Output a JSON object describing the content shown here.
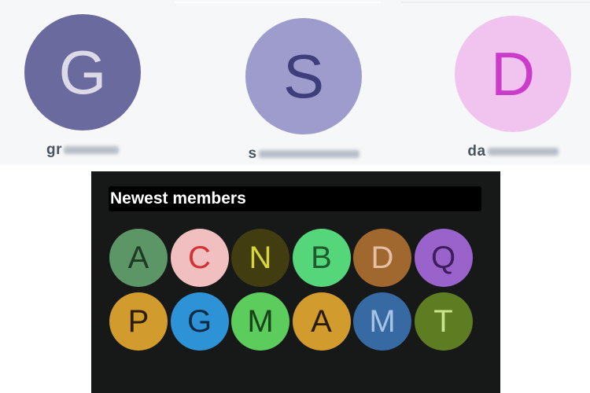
{
  "profiles": [
    {
      "letter": "G",
      "username_visible": "gr",
      "bg": "#6b6a9e",
      "fg": "#dcdae6"
    },
    {
      "letter": "S",
      "username_visible": "s",
      "bg": "#9d9ccd",
      "fg": "#3f3d7a"
    },
    {
      "letter": "D",
      "username_visible": "da",
      "bg": "#f0c4ef",
      "fg": "#cc3ccb"
    }
  ],
  "members_panel": {
    "title": "Newest members",
    "members": [
      {
        "letter": "A",
        "bg": "#5c9566",
        "fg": "#1d3a22"
      },
      {
        "letter": "C",
        "bg": "#f2bfc0",
        "fg": "#d23136"
      },
      {
        "letter": "N",
        "bg": "#413d10",
        "fg": "#d7d43c"
      },
      {
        "letter": "B",
        "bg": "#56d67b",
        "fg": "#1e5a2c"
      },
      {
        "letter": "D",
        "bg": "#a0682f",
        "fg": "#e3c0a4"
      },
      {
        "letter": "Q",
        "bg": "#9a63cc",
        "fg": "#3e1d5c"
      },
      {
        "letter": "P",
        "bg": "#d29b2e",
        "fg": "#2a1d08"
      },
      {
        "letter": "G",
        "bg": "#2e93d6",
        "fg": "#0e2d44"
      },
      {
        "letter": "M",
        "bg": "#5ccd5c",
        "fg": "#18431a"
      },
      {
        "letter": "A",
        "bg": "#d29b2e",
        "fg": "#2a1d08"
      },
      {
        "letter": "M",
        "bg": "#376aa3",
        "fg": "#a7c4e6"
      },
      {
        "letter": "T",
        "bg": "#5e7d22",
        "fg": "#c9e48e"
      }
    ]
  }
}
